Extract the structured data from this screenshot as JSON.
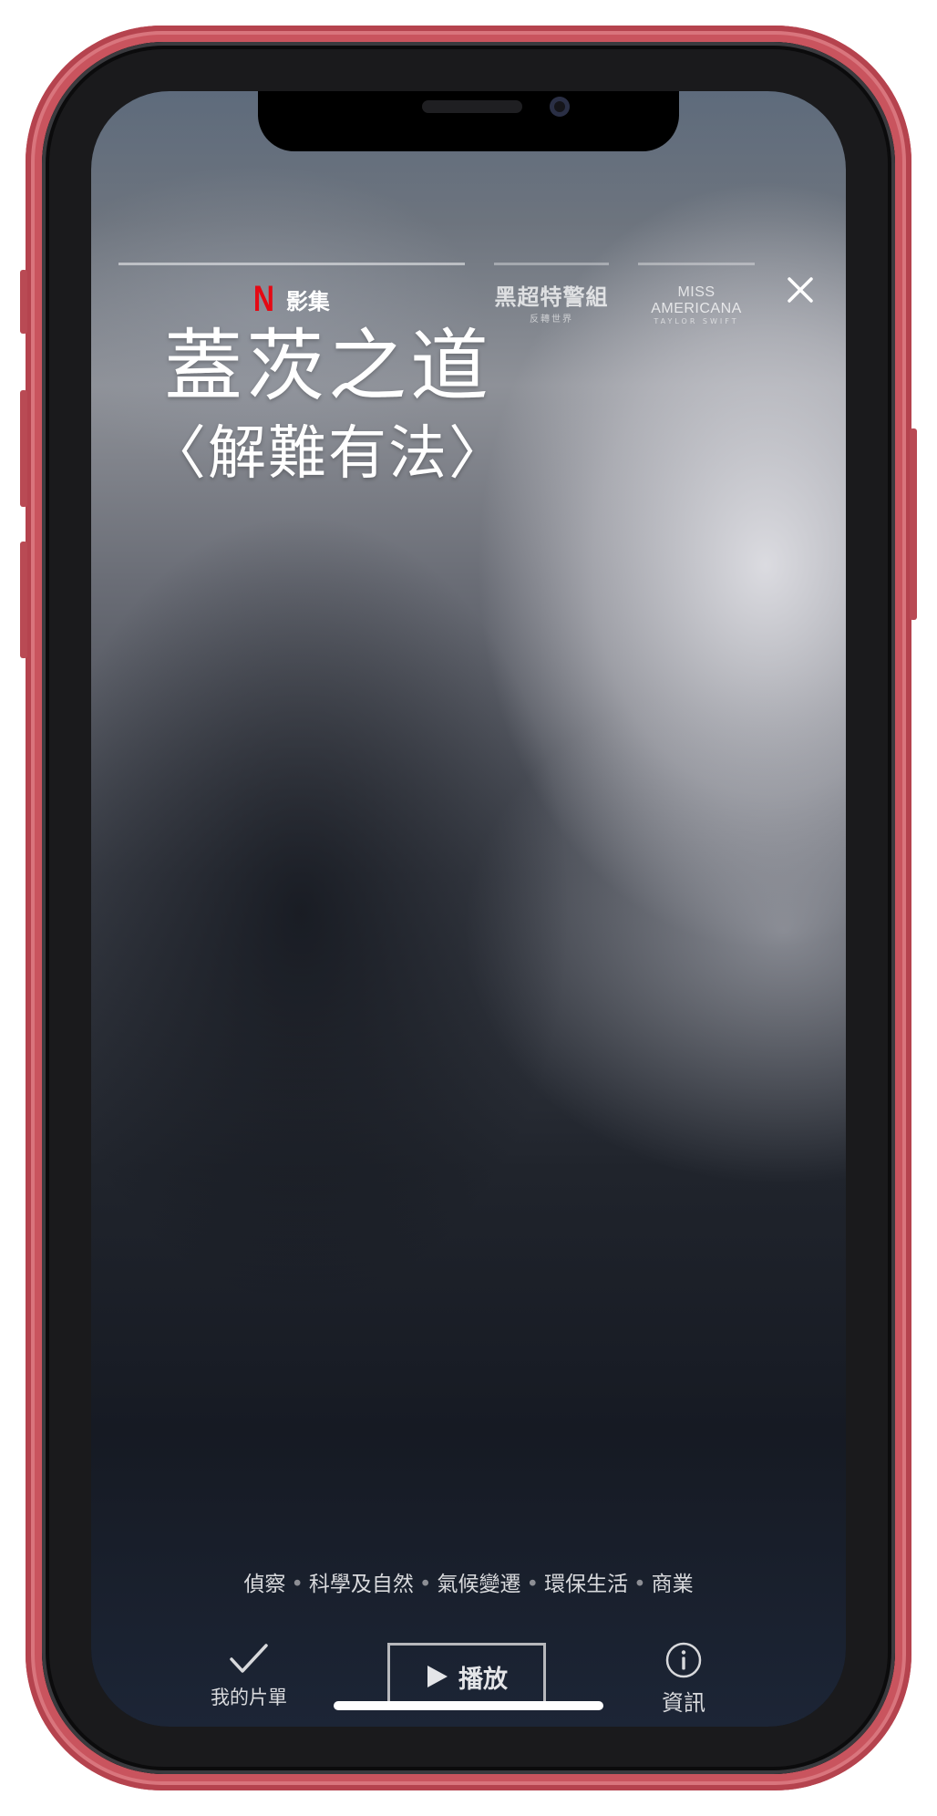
{
  "top_bar": {
    "brand_letter": "N",
    "category_label": "影集",
    "brand_color": "#e50914"
  },
  "previews": [
    {
      "title": "黑超特警組",
      "subtitle": "反轉世界"
    },
    {
      "title": "MISS AMERICANA",
      "subtitle": "TAYLOR SWIFT"
    }
  ],
  "close_icon": "close-icon",
  "show": {
    "title_line1": "蓋茨之道",
    "title_line2": "〈解難有法〉"
  },
  "genres": [
    "偵察",
    "科學及自然",
    "氣候變遷",
    "環保生活",
    "商業"
  ],
  "actions": {
    "my_list_label": "我的片單",
    "play_label": "播放",
    "info_label": "資訊"
  },
  "colors": {
    "device_frame": "#c9545e",
    "text_primary": "#ffffff",
    "text_muted": "#d8d9dc"
  }
}
